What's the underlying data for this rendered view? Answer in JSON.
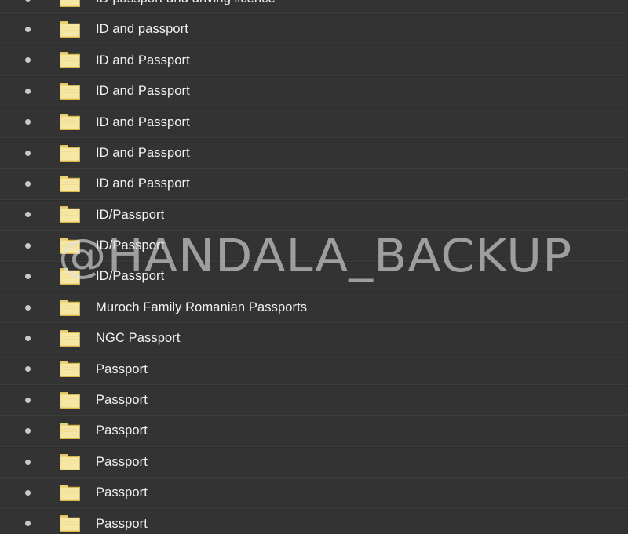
{
  "view": {
    "background_color": "#333333",
    "row_separator_color": "#3d3d3d",
    "text_color": "#f2f2f2",
    "bullet_color": "#c9c9c7"
  },
  "icons": {
    "folder": "folder-icon",
    "bullet": "bullet-dot-icon",
    "folder_fill_color": "#f7e7a4",
    "folder_border_color": "#d7b648",
    "folder_tab_color": "#e8cf72"
  },
  "watermark": {
    "text": "@HANDALA_BACKUP",
    "color": "#e1e1e1"
  },
  "folders": [
    {
      "name": "ID passport and driving licence"
    },
    {
      "name": "ID and passport"
    },
    {
      "name": "ID and Passport"
    },
    {
      "name": "ID and Passport"
    },
    {
      "name": "ID and Passport"
    },
    {
      "name": "ID and Passport"
    },
    {
      "name": "ID and Passport"
    },
    {
      "name": "ID/Passport"
    },
    {
      "name": "ID/Passport"
    },
    {
      "name": "ID/Passport"
    },
    {
      "name": "Muroch Family Romanian Passports"
    },
    {
      "name": "NGC Passport"
    },
    {
      "name": "Passport"
    },
    {
      "name": "Passport"
    },
    {
      "name": "Passport"
    },
    {
      "name": "Passport"
    },
    {
      "name": "Passport"
    },
    {
      "name": "Passport"
    }
  ]
}
